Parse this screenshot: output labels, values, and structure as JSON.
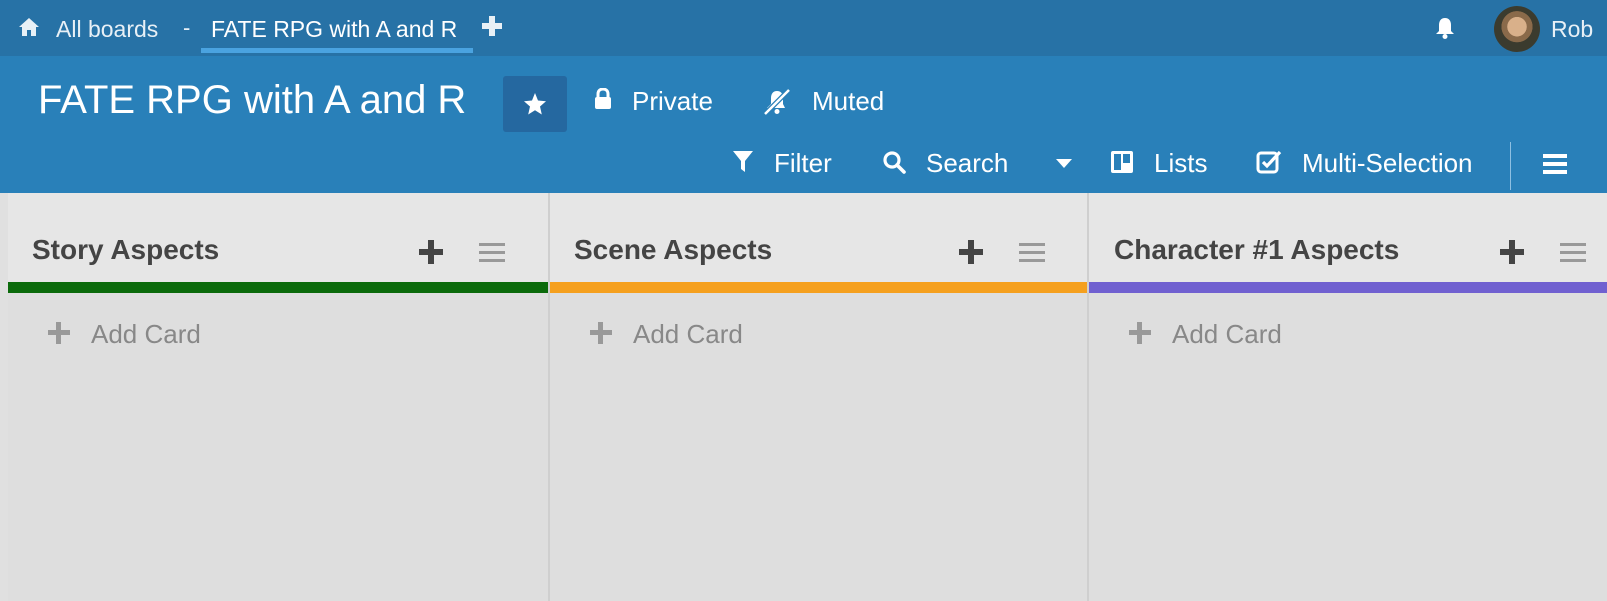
{
  "topbar": {
    "all_boards": "All boards",
    "separator": "-",
    "active_tab": "FATE RPG with A and R",
    "username": "Rob"
  },
  "board": {
    "title": "FATE RPG with A and R",
    "private_label": "Private",
    "muted_label": "Muted",
    "filter_label": "Filter",
    "search_label": "Search",
    "lists_label": "Lists",
    "multiselect_label": "Multi-Selection"
  },
  "lists": [
    {
      "title": "Story Aspects",
      "color": "#0b6a0b",
      "add_card": "Add Card"
    },
    {
      "title": "Scene Aspects",
      "color": "#f5a01e",
      "add_card": "Add Card"
    },
    {
      "title": "Character #1 Aspects",
      "color": "#7060d0",
      "add_card": "Add Card"
    }
  ],
  "colors": {
    "topbar": "#2772a6",
    "header": "#2980b9",
    "tab_underline": "#4aa3e0"
  }
}
